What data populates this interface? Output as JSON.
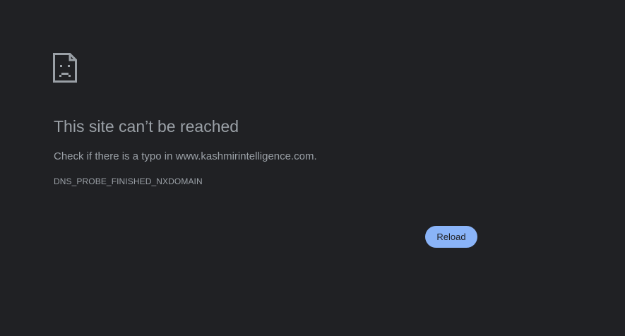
{
  "error_page": {
    "icon": "sad-page-icon",
    "title": "This site can’t be reached",
    "message": "Check if there is a typo in www.kashmirintelligence.com.",
    "error_code": "DNS_PROBE_FINISHED_NXDOMAIN",
    "reload_label": "Reload"
  },
  "colors": {
    "background": "#202124",
    "text": "#9aa0a6",
    "button_bg": "#8ab4f8",
    "button_text": "#202124"
  }
}
